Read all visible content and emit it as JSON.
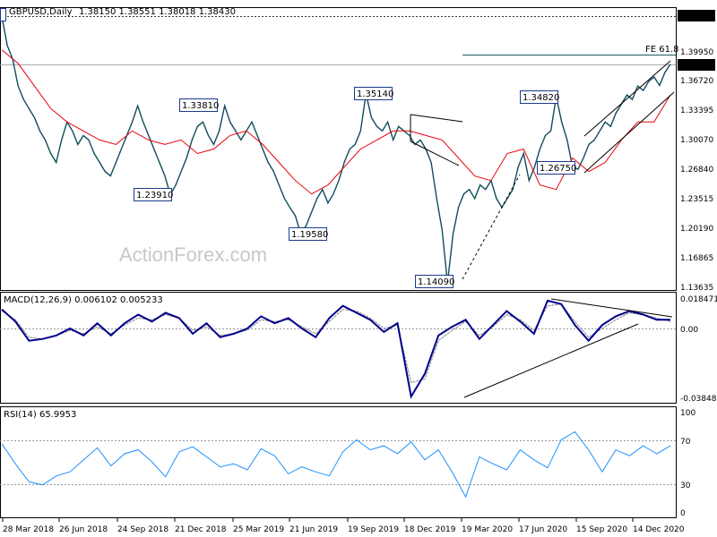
{
  "header": {
    "symbol": "GBPUSD,Daily",
    "ohlc": "1.38150 1.38551 1.38018 1.38430"
  },
  "watermark": "ActionForex.com",
  "colors": {
    "price": "#0f4c5c",
    "ma": "#e8000b",
    "macd": "#00008b",
    "signal": "#808080",
    "rsi": "#1e90ff",
    "trend": "#000000"
  },
  "chart_data": [
    {
      "type": "line",
      "title": "GBPUSD,Daily",
      "ylim": [
        1.13635,
        1.44
      ],
      "y_ticks": [
        "1.43760",
        "1.39950",
        "1.36720",
        "1.33395",
        "1.30070",
        "1.26840",
        "1.23515",
        "1.20190",
        "1.16865",
        "1.13635"
      ],
      "current_price": "1.38430",
      "fe_level": {
        "label": "FE 61.8",
        "value": 1.392
      },
      "horizontal_level": "1.43760",
      "series": [
        {
          "values": [
            1.4376,
            1.405,
            1.39,
            1.36,
            1.345,
            1.335,
            1.325,
            1.31,
            1.3,
            1.285,
            1.275,
            1.3,
            1.32,
            1.31,
            1.295,
            1.305,
            1.3,
            1.285,
            1.275,
            1.265,
            1.26,
            1.275,
            1.29,
            1.305,
            1.32,
            1.338,
            1.32,
            1.305,
            1.29,
            1.275,
            1.26,
            1.2391,
            1.25,
            1.265,
            1.28,
            1.3,
            1.315,
            1.32,
            1.305,
            1.295,
            1.31,
            1.3381,
            1.32,
            1.31,
            1.3,
            1.31,
            1.32,
            1.305,
            1.29,
            1.275,
            1.265,
            1.25,
            1.235,
            1.225,
            1.2158,
            1.1958,
            1.205,
            1.22,
            1.235,
            1.245,
            1.23,
            1.24,
            1.255,
            1.275,
            1.29,
            1.295,
            1.31,
            1.3514,
            1.325,
            1.315,
            1.31,
            1.32,
            1.3,
            1.315,
            1.31,
            1.305,
            1.295,
            1.3,
            1.29,
            1.275,
            1.235,
            1.2,
            1.1409,
            1.195,
            1.225,
            1.24,
            1.245,
            1.235,
            1.25,
            1.245,
            1.255,
            1.235,
            1.225,
            1.235,
            1.245,
            1.27,
            1.285,
            1.255,
            1.27,
            1.29,
            1.305,
            1.31,
            1.3482,
            1.32,
            1.3,
            1.27,
            1.2675,
            1.28,
            1.295,
            1.3,
            1.31,
            1.32,
            1.315,
            1.33,
            1.34,
            1.35,
            1.345,
            1.36,
            1.355,
            1.365,
            1.37,
            1.3605,
            1.375,
            1.3843
          ]
        },
        {
          "name": "MA",
          "values": [
            1.4,
            1.385,
            1.36,
            1.335,
            1.32,
            1.31,
            1.3,
            1.295,
            1.31,
            1.3,
            1.295,
            1.3,
            1.285,
            1.29,
            1.305,
            1.31,
            1.295,
            1.275,
            1.255,
            1.24,
            1.25,
            1.27,
            1.29,
            1.3,
            1.31,
            1.31,
            1.305,
            1.3,
            1.28,
            1.26,
            1.255,
            1.285,
            1.29,
            1.25,
            1.245,
            1.28,
            1.265,
            1.275,
            1.3,
            1.32,
            1.32,
            1.35
          ]
        }
      ],
      "annotations": [
        "1.43760",
        "1.33810",
        "1.23910",
        "1.19580",
        "1.35140",
        "1.14090",
        "1.34820",
        "1.26750"
      ],
      "x_tick_labels": [
        "28 Mar 2018",
        "26 Jun 2018",
        "24 Sep 2018",
        "21 Dec 2018",
        "25 Mar 2019",
        "21 Jun 2019",
        "19 Sep 2019",
        "18 Dec 2019",
        "19 Mar 2020",
        "17 Jun 2020",
        "15 Sep 2020",
        "14 Dec 2020"
      ]
    },
    {
      "type": "line",
      "title": "MACD(12,26,9) 0.006102 0.005233",
      "ylim": [
        -0.04,
        0.021
      ],
      "y_ticks": [
        "0.018471",
        "0.00",
        "-0.038486"
      ],
      "series": [
        {
          "name": "MACD",
          "values": [
            0.012,
            0.005,
            -0.006,
            -0.005,
            -0.003,
            0.001,
            -0.003,
            0.004,
            -0.003,
            0.004,
            0.009,
            0.005,
            0.01,
            0.007,
            -0.002,
            0.004,
            -0.004,
            -0.002,
            0.001,
            0.008,
            0.004,
            0.007,
            0.001,
            -0.004,
            0.007,
            0.014,
            0.01,
            0.006,
            -0.001,
            0.004,
            -0.038,
            -0.025,
            -0.003,
            0.002,
            0.006,
            -0.005,
            0.003,
            0.011,
            0.005,
            -0.002,
            0.017,
            0.015,
            0.003,
            -0.006,
            0.003,
            0.008,
            0.011,
            0.009,
            0.006,
            0.006
          ]
        },
        {
          "name": "Signal",
          "values": [
            0.011,
            0.006,
            -0.004,
            -0.005,
            -0.003,
            0.0,
            -0.002,
            0.002,
            -0.002,
            0.003,
            0.007,
            0.006,
            0.009,
            0.007,
            0.0,
            0.002,
            -0.003,
            -0.002,
            0.0,
            0.006,
            0.005,
            0.006,
            0.002,
            -0.002,
            0.005,
            0.012,
            0.011,
            0.007,
            0.001,
            0.003,
            -0.03,
            -0.028,
            -0.006,
            0.0,
            0.005,
            -0.003,
            0.002,
            0.009,
            0.006,
            0.0,
            0.014,
            0.015,
            0.005,
            -0.004,
            0.001,
            0.006,
            0.01,
            0.009,
            0.007,
            0.005
          ]
        }
      ]
    },
    {
      "type": "line",
      "title": "RSI(14) 65.9953",
      "ylim": [
        0,
        100
      ],
      "y_ticks": [
        "100",
        "70",
        "30",
        "0"
      ],
      "series": [
        {
          "name": "RSI",
          "values": [
            68,
            48,
            30,
            27,
            36,
            40,
            52,
            64,
            46,
            58,
            62,
            50,
            35,
            60,
            65,
            55,
            45,
            48,
            42,
            63,
            56,
            38,
            45,
            40,
            36,
            60,
            72,
            62,
            66,
            58,
            70,
            52,
            62,
            40,
            15,
            55,
            48,
            42,
            62,
            52,
            44,
            72,
            80,
            62,
            40,
            62,
            56,
            66,
            58,
            66
          ]
        }
      ]
    }
  ]
}
